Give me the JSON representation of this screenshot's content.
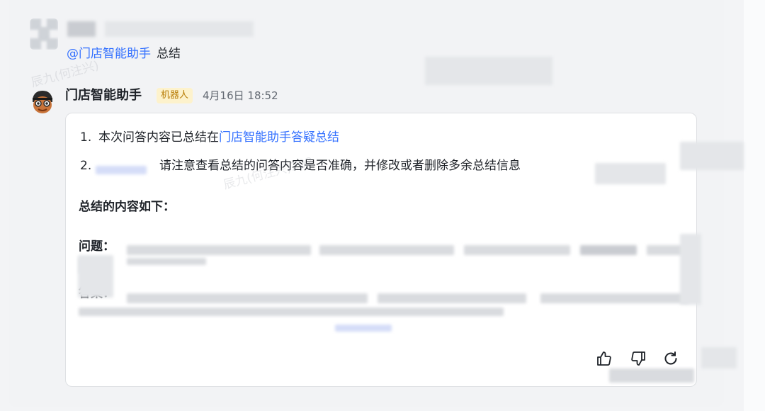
{
  "user_message": {
    "mention": "@门店智能助手",
    "text": "总结"
  },
  "bot": {
    "name": "门店智能助手",
    "badge": "机器人",
    "timestamp": "4月16日 18:52"
  },
  "card": {
    "item1_num": "1.",
    "item1_text": "本次问答内容已总结在",
    "item1_link": "门店智能助手答疑总结",
    "item2_num": "2.",
    "item2_text": "请注意查看总结的问答内容是否准确，并修改或者删除多余总结信息",
    "summary_heading": "总结的内容如下：",
    "question_label": "问题：",
    "answer_label": "答案："
  },
  "watermark": {
    "text1": "辰九(何注兴)",
    "text2": "辰九(何注兴)202"
  },
  "icons": {
    "like": "thumbs-up-icon",
    "dislike": "thumbs-down-icon",
    "regenerate": "refresh-icon"
  },
  "colors": {
    "link": "#3370ff",
    "badge_bg": "#fdf2cc",
    "badge_text": "#b87d08"
  }
}
